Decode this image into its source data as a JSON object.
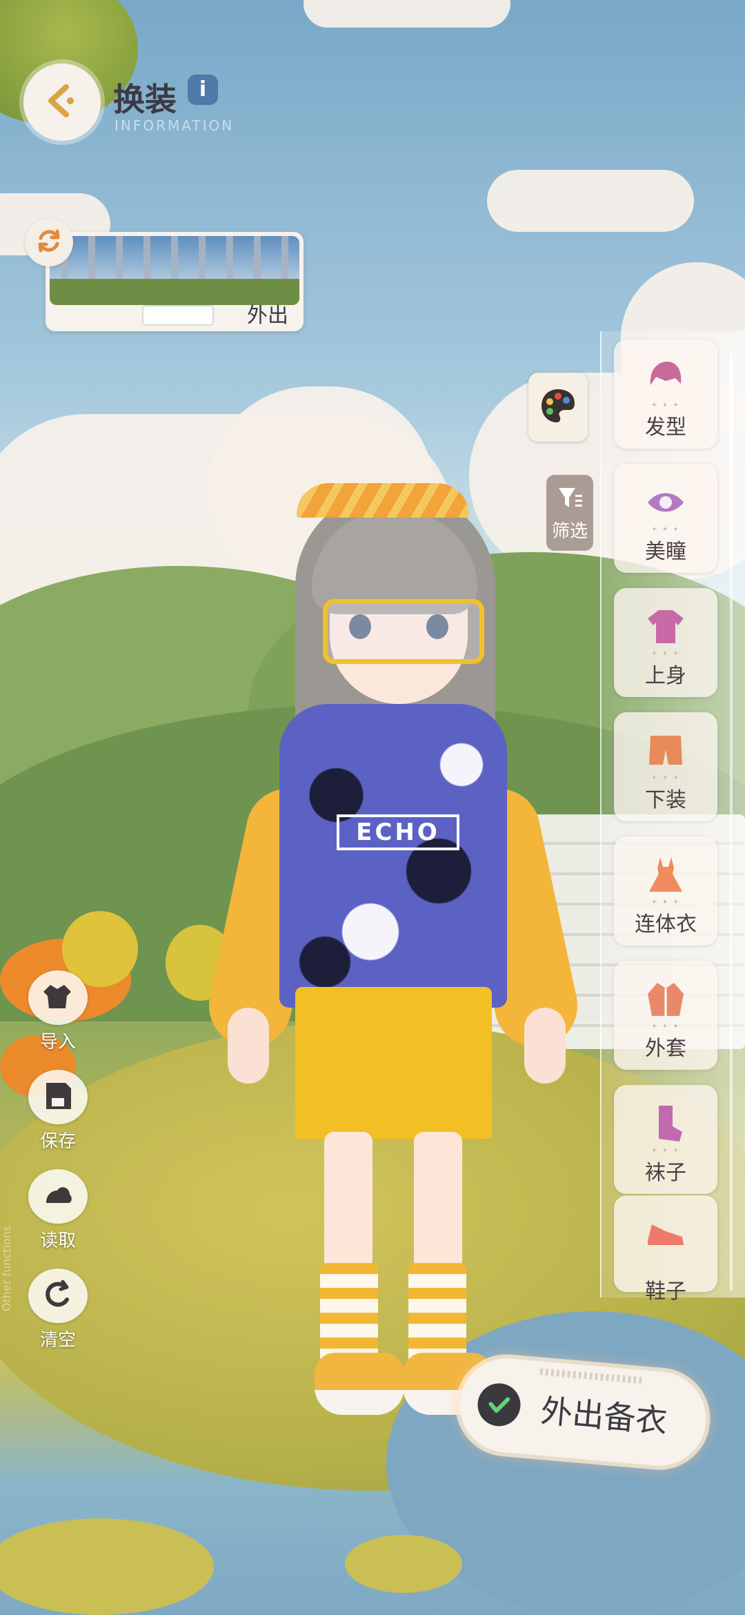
{
  "header": {
    "title": "换装",
    "info_badge": "i",
    "subtitle": "INFORMATION",
    "back_icon": "back-arrow-icon"
  },
  "scene": {
    "label": "外出",
    "swap_icon": "refresh-icon"
  },
  "tools": {
    "palette_icon": "palette-icon",
    "filter_label": "筛选",
    "filter_icon": "filter-icon"
  },
  "categories": [
    {
      "label": "发型",
      "icon": "hair-icon"
    },
    {
      "label": "美瞳",
      "icon": "eye-icon"
    },
    {
      "label": "上身",
      "icon": "shirt-icon"
    },
    {
      "label": "下装",
      "icon": "shorts-icon"
    },
    {
      "label": "连体衣",
      "icon": "dress-icon"
    },
    {
      "label": "外套",
      "icon": "jacket-icon"
    },
    {
      "label": "袜子",
      "icon": "sock-icon"
    },
    {
      "label": "鞋子",
      "icon": "shoe-icon"
    }
  ],
  "functions": [
    {
      "label": "导入",
      "icon": "import-icon"
    },
    {
      "label": "保存",
      "icon": "save-icon"
    },
    {
      "label": "读取",
      "icon": "load-icon"
    },
    {
      "label": "清空",
      "icon": "clear-icon"
    }
  ],
  "other_functions_label": "Other functions",
  "character": {
    "hoodie_text": "ECHO"
  },
  "confirm": {
    "label": "外出备衣",
    "icon": "check-icon"
  },
  "colors": {
    "accent": "#f2c024",
    "text_dark": "#3b3b44",
    "info_badge": "#4e79a8"
  }
}
